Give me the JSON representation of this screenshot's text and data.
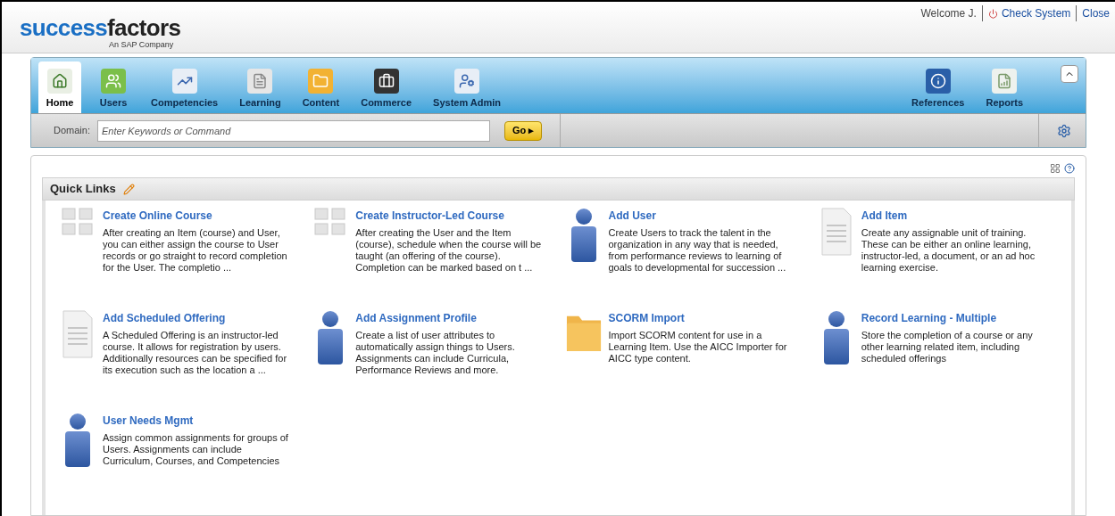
{
  "header": {
    "logo": {
      "name_part1": "success",
      "name_part2": "factors",
      "tagline": "An SAP Company"
    },
    "links": [
      {
        "text": "Welcome J."
      },
      {
        "text": "Check System",
        "kind": "power"
      },
      {
        "text": "Close"
      }
    ]
  },
  "nav": {
    "tabs": [
      {
        "label": "Home",
        "kind": "home",
        "selected": true
      },
      {
        "label": "Users",
        "kind": "users",
        "selected": false
      },
      {
        "label": "Competencies",
        "kind": "chart",
        "selected": false
      },
      {
        "label": "Learning",
        "kind": "doc",
        "selected": false
      },
      {
        "label": "Content",
        "kind": "folder",
        "selected": false
      },
      {
        "label": "Commerce",
        "kind": "bag",
        "selected": false
      },
      {
        "label": "System Admin",
        "kind": "admin",
        "selected": false
      }
    ],
    "right_tabs": [
      {
        "label": "References",
        "kind": "info",
        "selected": false
      },
      {
        "label": "Reports",
        "kind": "report",
        "selected": false
      }
    ]
  },
  "search": {
    "label": "Domain:",
    "placeholder": "Enter Keywords or Command",
    "button": "Go ▸"
  },
  "quick_links": {
    "title": "Quick Links",
    "items": [
      {
        "title": "Create Online Course",
        "kind": "grid",
        "description": "After creating an Item (course) and User, you can either assign the course to User records or go straight to record completion for the User. The completio ..."
      },
      {
        "title": "Create Instructor-Led Course",
        "kind": "grid",
        "description": "After creating the User and the Item (course), schedule when the course will be taught (an offering of the course). Completion can be marked based on t ..."
      },
      {
        "title": "Add User",
        "kind": "person",
        "description": "Create Users to track the talent in the organization in any way that is needed, from performance reviews to learning of goals to developmental for succession ..."
      },
      {
        "title": "Add Item",
        "kind": "document",
        "description": "Create any assignable unit of training. These can be either an online learning, instructor-led, a document, or an ad hoc learning exercise."
      },
      {
        "title": "Add Scheduled Offering",
        "kind": "document",
        "description": "A Scheduled Offering is an instructor-led course. It allows for registration by users. Additionally resources can be specified for its execution such as the location a ..."
      },
      {
        "title": "Add Assignment Profile",
        "kind": "person",
        "description": "Create a list of user attributes to automatically assign things to Users. Assignments can include Curricula, Performance Reviews and more."
      },
      {
        "title": "SCORM Import",
        "kind": "folder",
        "description": "Import SCORM content for use in a Learning Item. Use the AICC Importer for AICC type content."
      },
      {
        "title": "Record Learning - Multiple",
        "kind": "person",
        "description": "Store the completion of a course or any other learning related item, including scheduled offerings"
      },
      {
        "title": "User Needs Mgmt",
        "kind": "person",
        "description": "Assign common assignments for groups of Users. Assignments can include Curriculum, Courses, and Competencies"
      }
    ]
  }
}
